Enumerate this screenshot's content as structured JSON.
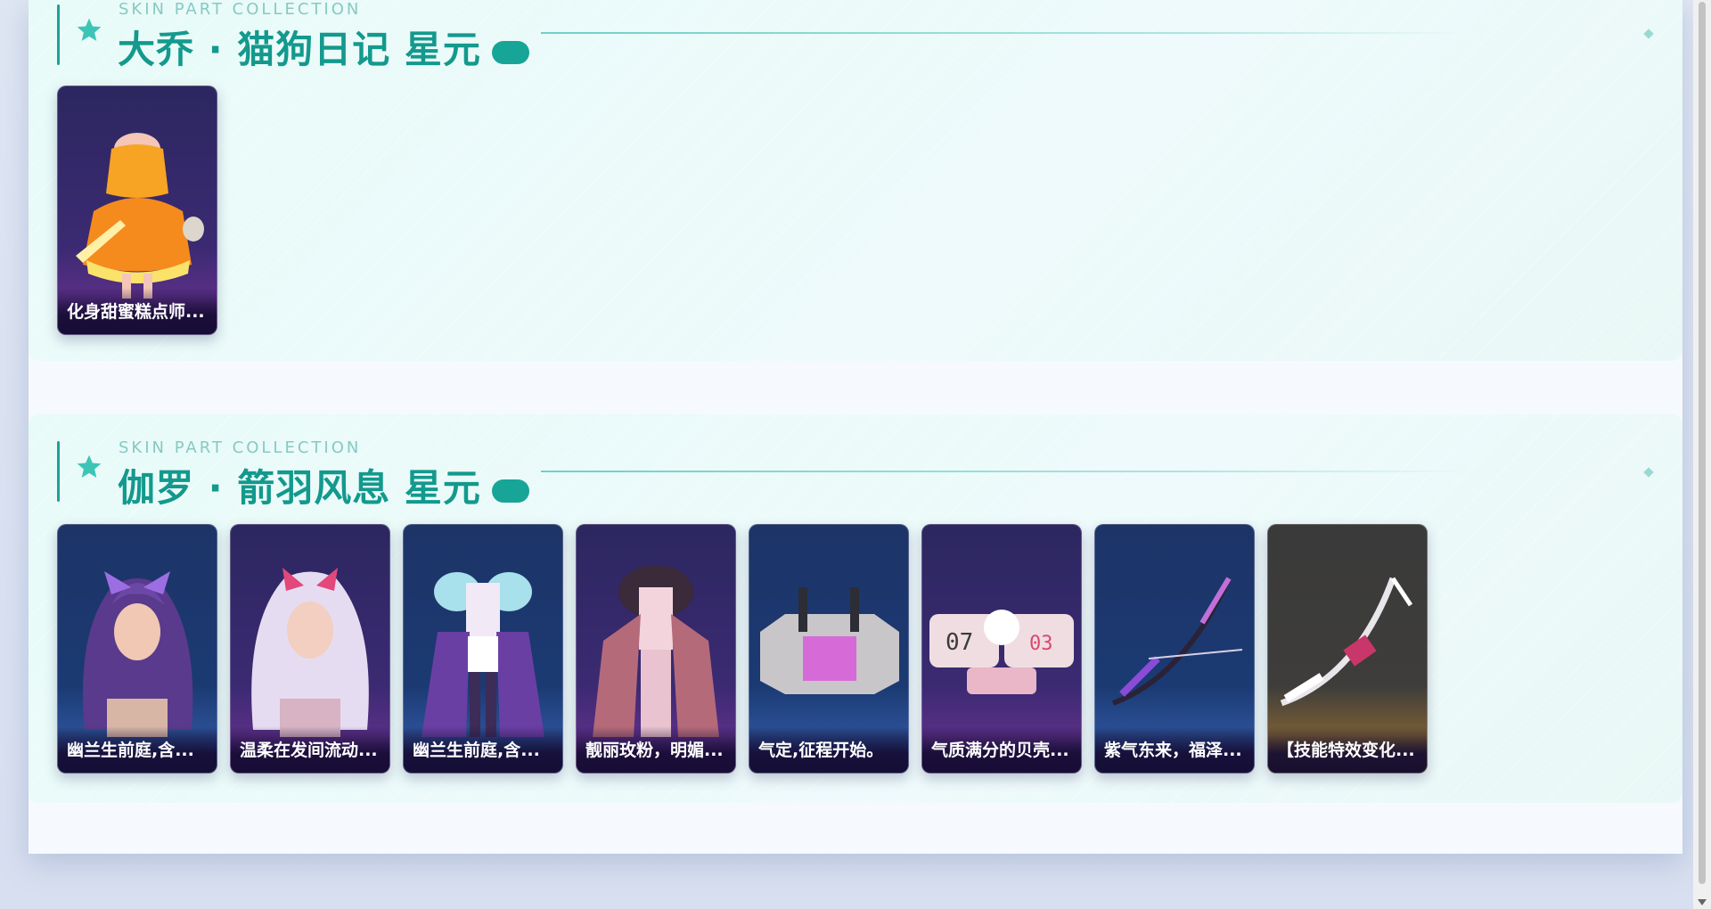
{
  "sections": [
    {
      "eyebrow": "SKIN PART COLLECTION",
      "title": "大乔 · 猫狗日记 星元",
      "cards": [
        {
          "caption": "化身甜蜜糕点师..."
        }
      ]
    },
    {
      "eyebrow": "SKIN PART COLLECTION",
      "title": "伽罗 · 箭羽风息 星元",
      "cards": [
        {
          "caption": "幽兰生前庭,含..."
        },
        {
          "caption": "温柔在发间流动..."
        },
        {
          "caption": "幽兰生前庭,含..."
        },
        {
          "caption": "靓丽玫粉，明媚..."
        },
        {
          "caption": "气定,征程开始。"
        },
        {
          "caption": "气质满分的贝壳..."
        },
        {
          "caption": "紫气东来，福泽..."
        },
        {
          "caption": "【技能特效变化..."
        }
      ]
    }
  ],
  "colors": {
    "accent": "#13998d",
    "eyebrow": "#87c9c3",
    "section_bg": "#e8fbf8",
    "page_bg": "#f6f9fd"
  },
  "icons": [
    "star-icon",
    "pill-badge",
    "diamond-ornament"
  ]
}
